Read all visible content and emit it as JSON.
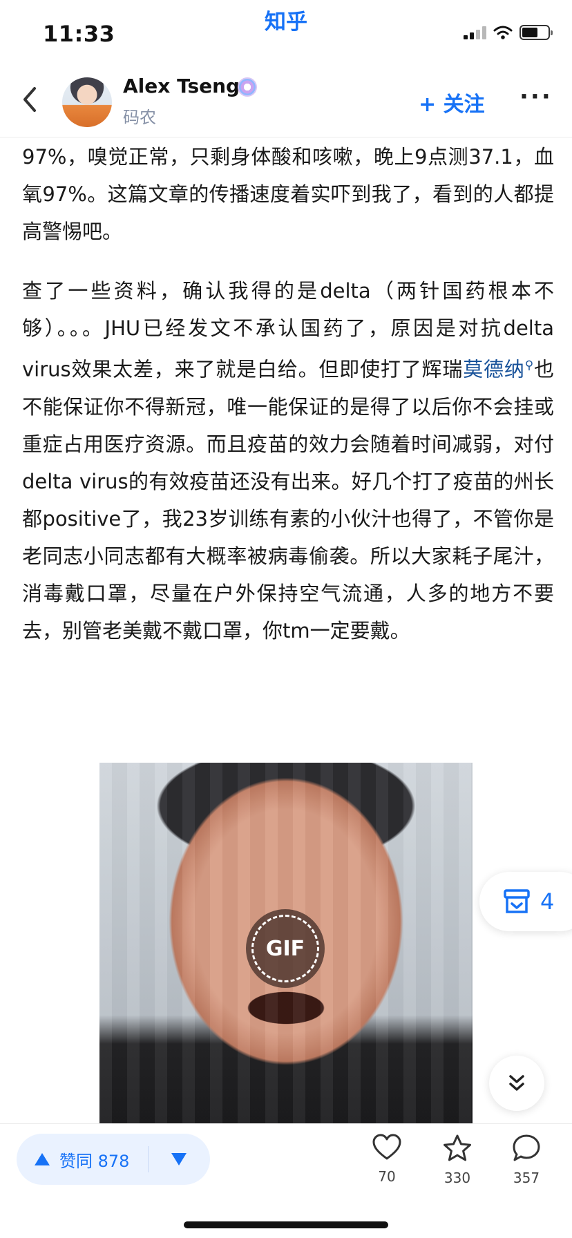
{
  "status_bar": {
    "time": "11:33",
    "app_name": "知乎"
  },
  "author": {
    "name": "Alex Tseng",
    "title": "码农",
    "follow_label": "+ 关注",
    "more_label": "···"
  },
  "article": {
    "p1": "97%，嗅觉正常，只剩身体酸和咳嗽，晚上9点测37.1，血氧97%。这篇文章的传播速度着实吓到我了，看到的人都提高警惕吧。",
    "p2_before_link": "查了一些资料，确认我得的是delta（两针国药根本不够）。。。JHU已经发文不承认国药了，原因是对抗delta virus效果太差，来了就是白给。但即使打了辉瑞",
    "p2_link": "莫德纳",
    "p2_after_link": "也不能保证你不得新冠，唯一能保证的是得了以后你不会挂或重症占用医疗资源。而且疫苗的效力会随着时间减弱，对付delta virus的有效疫苗还没有出来。好几个打了疫苗的州长都positive了，我23岁训练有素的小伙汁也得了，不管你是老同志小同志都有大概率被病毒偷袭。所以大家耗子尾汁，消毒戴口罩，尽量在户外保持空气流通，人多的地方不要去，别管老美戴不戴口罩，你tm一定要戴。",
    "gif_label": "GIF"
  },
  "floating": {
    "collect_count": "4"
  },
  "bottom_bar": {
    "vote_up_label": "赞同 878",
    "like_count": "70",
    "favorite_count": "330",
    "comment_count": "357"
  },
  "colors": {
    "brand": "#1772F6",
    "link": "#175199",
    "vote_bg": "#eaf2ff"
  }
}
